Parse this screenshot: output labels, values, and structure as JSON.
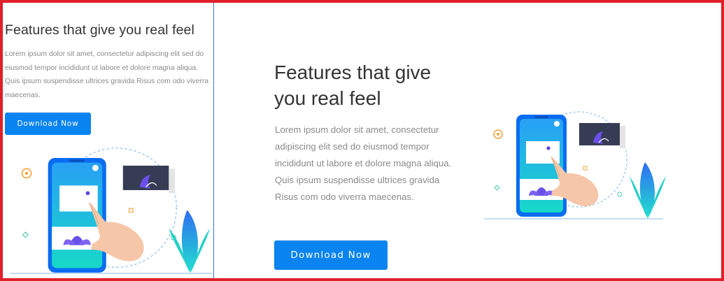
{
  "feature_section": {
    "title": "Features that give you real feel",
    "title_line1": "Features that give",
    "title_line2": "you real feel",
    "description": "Lorem ipsum dolor sit amet, consectetur adipiscing elit sed do eiusmod tempor incididunt ut labore et dolore magna aliqua. Quis ipsum suspendisse ultrices gravida Risus com odo viverra maecenas.",
    "button_label": "Download Now"
  },
  "colors": {
    "accent": "#0a84f0",
    "frame": "#e0202a",
    "divider": "#3a78d8",
    "heading": "#333333",
    "body_text": "#8a8a8a"
  },
  "icons": {
    "illustration": "phone-touch-illustration",
    "plant": "leaf-plant-icon",
    "lotus": "lotus-icon"
  }
}
